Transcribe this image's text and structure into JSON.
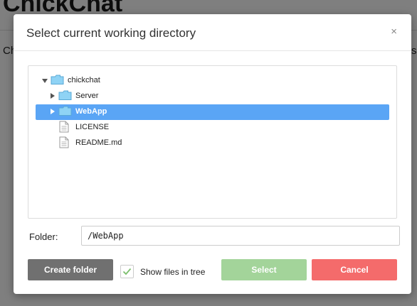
{
  "background": {
    "title": "ChickChat",
    "text_left": "Ch",
    "text_right": "sh"
  },
  "dialog": {
    "title": "Select current working directory",
    "close_label": "×",
    "tree": [
      {
        "label": "chickchat",
        "type": "folder",
        "expanded": true,
        "depth": 0,
        "selected": false
      },
      {
        "label": "Server",
        "type": "folder",
        "expanded": false,
        "depth": 1,
        "selected": false
      },
      {
        "label": "WebApp",
        "type": "folder",
        "expanded": false,
        "depth": 1,
        "selected": true
      },
      {
        "label": "LICENSE",
        "type": "file",
        "depth": 1,
        "selected": false
      },
      {
        "label": "README.md",
        "type": "file",
        "depth": 1,
        "selected": false
      }
    ],
    "folder_label": "Folder:",
    "folder_value": "/WebApp",
    "create_folder_label": "Create folder",
    "show_files_label": "Show files in tree",
    "show_files_checked": true,
    "select_label": "Select",
    "cancel_label": "Cancel"
  },
  "colors": {
    "selection": "#5aa5f5",
    "folder_icon": "#8fd3f5",
    "create_button": "#707070",
    "select_button": "#a3d49a",
    "cancel_button": "#f46b6b",
    "checkmark": "#7cbf6d"
  }
}
